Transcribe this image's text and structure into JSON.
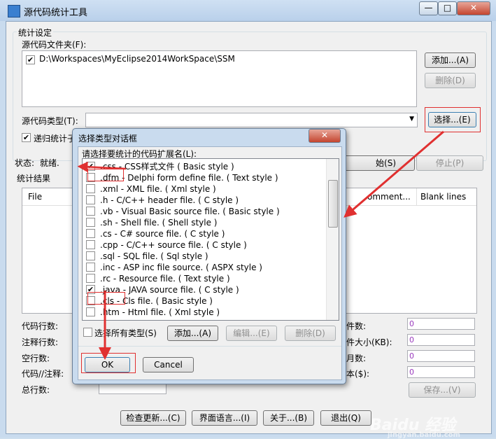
{
  "window": {
    "title": "源代码统计工具",
    "min_glyph": "—",
    "max_glyph": "□",
    "close_glyph": "✕"
  },
  "settings": {
    "group_label": "统计设定",
    "folder_label": "源代码文件夹(F):",
    "folder_path": "D:\\Workspaces\\MyEclipse2014WorkSpace\\SSM",
    "add_btn": "添加...(A)",
    "delete_btn": "删除(D)",
    "type_label": "源代码类型(T):",
    "select_btn": "选择...(E)",
    "recursive_label": "递归统计子"
  },
  "status": {
    "label": "状态:",
    "value": "就绪.",
    "start_btn_partial": "始(S)",
    "stop_btn": "停止(P)"
  },
  "results": {
    "group_label": "统计结果",
    "columns": [
      "File",
      "omment...",
      "Blank lines"
    ]
  },
  "stats_left": [
    "代码行数:",
    "注释行数:",
    "空行数:",
    "代码//注释:",
    "总行数:"
  ],
  "stats_right": [
    {
      "label": "件数:",
      "value": "0"
    },
    {
      "label": "件大小(KB):",
      "value": "0"
    },
    {
      "label": "月数:",
      "value": "0"
    },
    {
      "label": "本($):",
      "value": "0"
    }
  ],
  "save_btn": "保存...(V)",
  "bottom_buttons": [
    "检查更新...(C)",
    "界面语言...(I)",
    "关于...(B)",
    "退出(Q)"
  ],
  "dialog": {
    "title": "选择类型对话框",
    "prompt": "请选择要统计的代码扩展名(L):",
    "items": [
      {
        "text": ".css - CSS样式文件 ( Basic style )",
        "checked": true
      },
      {
        "text": ".dfm - Delphi form define file. ( Text style )",
        "checked": false
      },
      {
        "text": ".xml - XML file. ( Xml style )",
        "checked": false
      },
      {
        "text": ".h - C/C++ header file. ( C style )",
        "checked": false
      },
      {
        "text": ".vb - Visual Basic source file. ( Basic style )",
        "checked": false
      },
      {
        "text": ".sh - Shell file. ( Shell style )",
        "checked": false
      },
      {
        "text": ".cs - C# source file. ( C style )",
        "checked": false
      },
      {
        "text": ".cpp - C/C++ source file. ( C style )",
        "checked": false
      },
      {
        "text": ".sql - SQL file. ( Sql style )",
        "checked": false
      },
      {
        "text": ".inc - ASP inc file source. ( ASPX style )",
        "checked": false
      },
      {
        "text": ".rc - Resource file. ( Text style )",
        "checked": false
      },
      {
        "text": ".java - JAVA source file. ( C style )",
        "checked": true
      },
      {
        "text": ".cls - Cls file. ( Basic style )",
        "checked": false
      },
      {
        "text": ".htm - Html file. ( Xml style )",
        "checked": false
      }
    ],
    "select_all_label": "选择所有类型(S)",
    "add_btn": "添加...(A)",
    "edit_btn": "编辑...(E)",
    "delete_btn": "删除(D)",
    "ok_btn": "OK",
    "cancel_btn": "Cancel",
    "close_glyph": "✕"
  },
  "watermark": {
    "brand": "Baidu 经验",
    "url": "jingyan.baidu.com"
  },
  "colors": {
    "accent_red": "#e03030",
    "value_purple": "#9a3bbd"
  }
}
